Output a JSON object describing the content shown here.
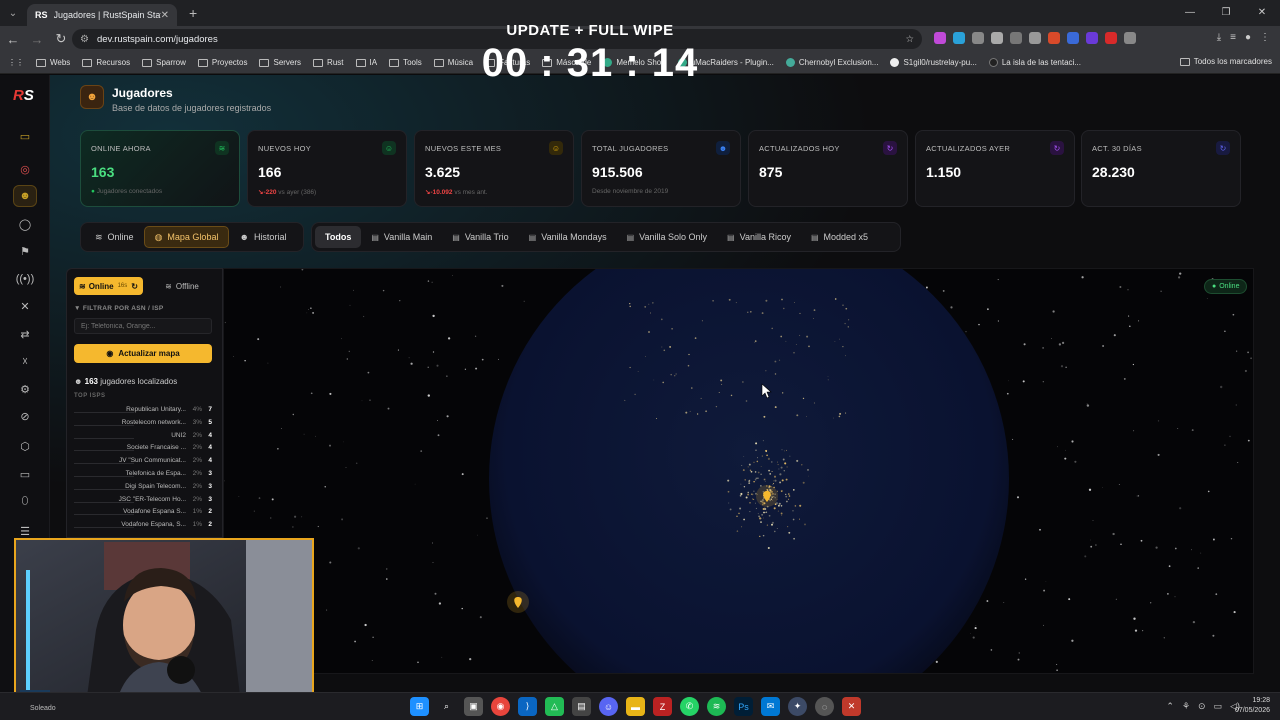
{
  "browser": {
    "tab_title": "Jugadores | RustSpain Staff",
    "tab_favicon": "RS",
    "url": "dev.rustspain.com/jugadores",
    "bookmarks": [
      "Webs",
      "Recursos",
      "Sparrow",
      "Proyectos",
      "Servers",
      "Rust",
      "IA",
      "Tools",
      "Música",
      "Facturas",
      "Máscarde",
      "Memelo Shop",
      "uMacRaiders - Plugin...",
      "Chernobyl Exclusion...",
      "S1gil0/rustrelay-pu...",
      "La isla de las tentaci..."
    ],
    "bookmarks_all": "Todos los marcadores"
  },
  "overlay": {
    "title": "UPDATE + FULL WIPE",
    "timer": "00 : 31 : 14"
  },
  "sidebar": {
    "logo": "RS",
    "icons": [
      "grid-icon",
      "map-pin-icon",
      "users-icon",
      "shield-icon",
      "flag-icon",
      "broadcast-icon",
      "mute-icon",
      "swap-icon",
      "user-x-icon",
      "settings-icon",
      "ban-icon",
      "shield-2-icon",
      "monitor-icon",
      "shield-3-icon",
      "database-icon"
    ]
  },
  "header": {
    "title": "Jugadores",
    "subtitle": "Base de datos de jugadores registrados"
  },
  "stats": [
    {
      "label": "ONLINE AHORA",
      "value": "163",
      "sub": "Jugadores conectados",
      "delta": "",
      "color": "#22c55e"
    },
    {
      "label": "NUEVOS HOY",
      "value": "166",
      "sub": "vs ayer (386)",
      "delta": "-220",
      "color": "#22c55e"
    },
    {
      "label": "NUEVOS ESTE MES",
      "value": "3.625",
      "sub": "vs mes ant.",
      "delta": "-10.092",
      "color": "#eab308"
    },
    {
      "label": "TOTAL JUGADORES",
      "value": "915.506",
      "sub": "Desde noviembre de 2019",
      "delta": "",
      "color": "#3b82f6"
    },
    {
      "label": "ACTUALIZADOS HOY",
      "value": "875",
      "sub": "",
      "delta": "",
      "color": "#a855f7"
    },
    {
      "label": "ACTUALIZADOS AYER",
      "value": "1.150",
      "sub": "",
      "delta": "",
      "color": "#a855f7"
    },
    {
      "label": "ACT. 30 DÍAS",
      "value": "28.230",
      "sub": "",
      "delta": "",
      "color": "#6366f1"
    }
  ],
  "modes": [
    "Online",
    "Mapa Global",
    "Historial"
  ],
  "servers": [
    "Todos",
    "Vanilla Main",
    "Vanilla Trio",
    "Vanilla Mondays",
    "Vanilla Solo Only",
    "Vanilla Ricoy",
    "Modded x5"
  ],
  "panel": {
    "online_label": "Online",
    "online_badge": "16s",
    "offline_label": "Offline",
    "filter_label": "FILTRAR POR ASN / ISP",
    "filter_placeholder": "Ej: Telefonica, Orange...",
    "update_button": "Actualizar mapa",
    "located_count": "163",
    "located_text": "jugadores localizados",
    "top_isps_label": "TOP ISPS",
    "isps": [
      {
        "name": "Republican Unitary...",
        "pct": "4%",
        "count": "7"
      },
      {
        "name": "Rostelecom network...",
        "pct": "3%",
        "count": "5"
      },
      {
        "name": "UNI2",
        "pct": "2%",
        "count": "4"
      },
      {
        "name": "Societe Francaise ...",
        "pct": "2%",
        "count": "4"
      },
      {
        "name": "JV \"Sun Communicat...",
        "pct": "2%",
        "count": "4"
      },
      {
        "name": "Telefonica de Espa...",
        "pct": "2%",
        "count": "3"
      },
      {
        "name": "Digi Spain Telecom...",
        "pct": "2%",
        "count": "3"
      },
      {
        "name": "JSC \"ER-Telecom Ho...",
        "pct": "2%",
        "count": "3"
      },
      {
        "name": "Vodafone Espana S...",
        "pct": "1%",
        "count": "2"
      },
      {
        "name": "Vodafone Espana, S...",
        "pct": "1%",
        "count": "2"
      }
    ]
  },
  "map": {
    "status_badge": "Online"
  },
  "taskbar": {
    "time": "19:28",
    "date": "07/05/2026",
    "weather": "Soleado"
  }
}
